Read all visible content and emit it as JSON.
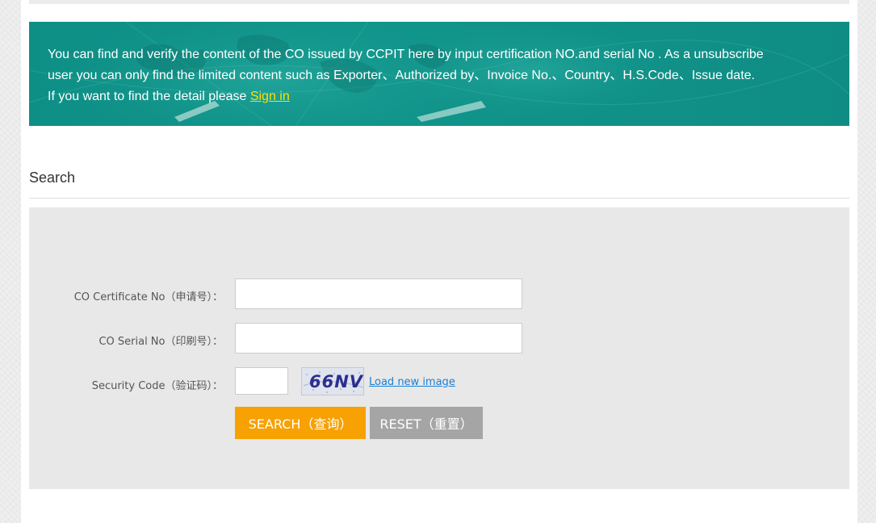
{
  "banner": {
    "text_line1": "You can find and verify  the content of the CO issued by CCPIT here by input certification NO.and serial No . As a unsubscribe",
    "text_line2": "user  you can only find the   limited content such as Exporter、Authorized by、Invoice No.、Country、H.S.Code、Issue date.",
    "text_line3": "If you want to find the detail please ",
    "signin_label": "Sign in",
    "colors": {
      "background": "#0f8f87",
      "link": "#ffe000"
    }
  },
  "search": {
    "title": "Search"
  },
  "form": {
    "certificate_label": "CO Certificate No（申请号）：",
    "certificate_value": "",
    "serial_label": "CO Serial No（印刷号）：",
    "serial_value": "",
    "security_label": "Security Code（验证码）：",
    "security_value": "",
    "captcha_text": "66NV",
    "load_new_image_label": "Load new image"
  },
  "buttons": {
    "search_label": "SEARCH（查询）",
    "reset_label": "RESET（重置）",
    "colors": {
      "search": "#f7a102",
      "reset": "#a5a5a5"
    }
  }
}
